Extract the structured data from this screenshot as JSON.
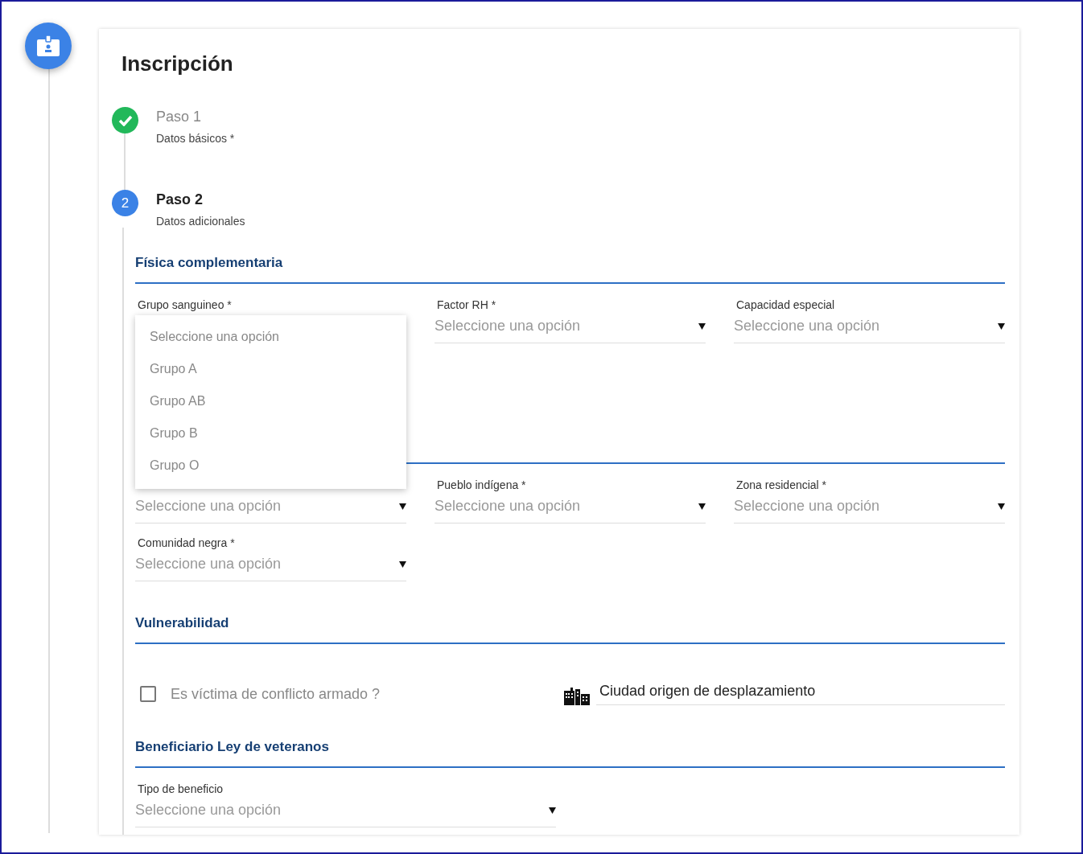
{
  "header": {
    "title": "Inscripción"
  },
  "steps": [
    {
      "label": "Paso 1",
      "sublabel": "Datos básicos *",
      "completed": true,
      "active": false
    },
    {
      "label": "Paso 2",
      "sublabel": "Datos adicionales",
      "completed": false,
      "active": true,
      "number": "2"
    }
  ],
  "sections": [
    {
      "title": "Física complementaria",
      "fields": [
        {
          "kind": "select",
          "label": "Grupo sanguineo *",
          "open": true,
          "options": [
            "Seleccione una opción",
            "Grupo A",
            "Grupo AB",
            "Grupo B",
            "Grupo O"
          ]
        },
        {
          "kind": "select",
          "label": "Factor RH *",
          "placeholder": "Seleccione una opción"
        },
        {
          "kind": "select",
          "label": "Capacidad especial",
          "placeholder": "Seleccione una opción"
        }
      ]
    },
    {
      "fields": [
        {
          "kind": "select",
          "placeholder": "Seleccione una opción"
        },
        {
          "kind": "select",
          "label": "Pueblo indígena *",
          "placeholder": "Seleccione una opción"
        },
        {
          "kind": "select",
          "label": "Zona residencial *",
          "placeholder": "Seleccione una opción"
        },
        {
          "kind": "select",
          "label": "Comunidad negra *",
          "placeholder": "Seleccione una opción"
        }
      ]
    },
    {
      "title": "Vulnerabilidad",
      "fields": [
        {
          "kind": "checkbox",
          "label": "Es víctima de conflicto armado ?",
          "checked": false
        },
        {
          "kind": "city",
          "placeholder": "Ciudad origen de desplazamiento"
        }
      ]
    },
    {
      "title": "Beneficiario Ley de veteranos",
      "fields": [
        {
          "kind": "select",
          "label": "Tipo de beneficio",
          "placeholder": "Seleccione una opción"
        }
      ]
    }
  ]
}
